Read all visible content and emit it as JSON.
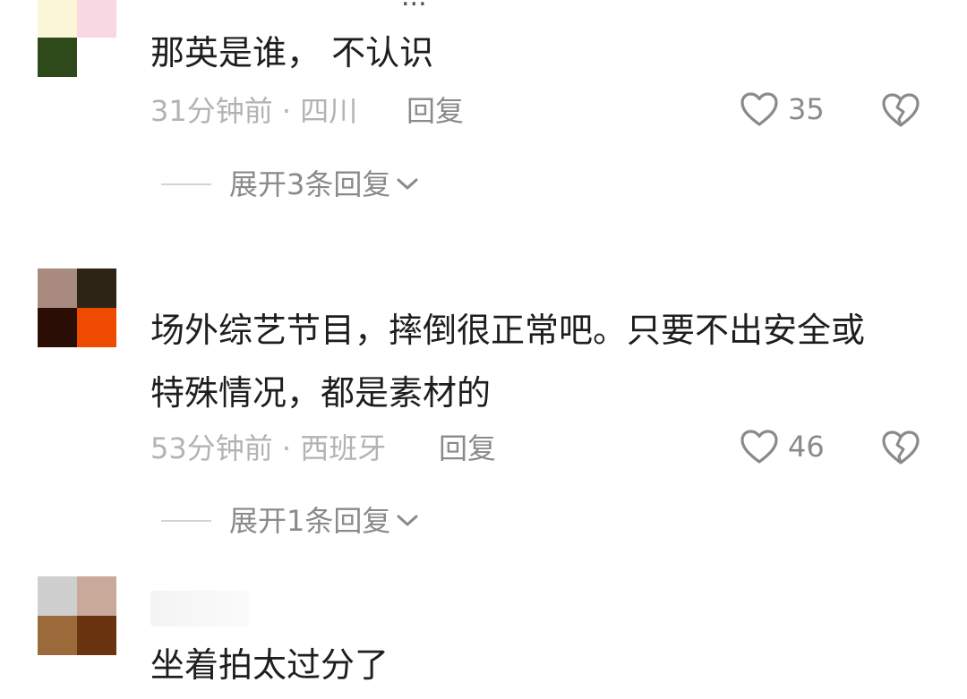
{
  "top_partial_text": "...",
  "comments": [
    {
      "text": "那英是谁， 不认识",
      "time_location": "31分钟前 · 四川",
      "reply_label": "回复",
      "likes": "35",
      "expand_label": "展开3条回复"
    },
    {
      "text_line1": "场外综艺节目，摔倒很正常吧。只要不出安全或",
      "text_line2": "特殊情况，都是素材的",
      "time_location": "53分钟前 · 西班牙",
      "reply_label": "回复",
      "likes": "46",
      "expand_label": "展开1条回复"
    },
    {
      "text": "坐着拍太过分了"
    }
  ],
  "icons": {
    "like": "heart-outline-icon",
    "dislike": "broken-heart-icon",
    "expand": "chevron-down-icon"
  },
  "colors": {
    "text": "#1e1e1e",
    "meta": "#b3b3b3",
    "action": "#8a8a8a"
  }
}
